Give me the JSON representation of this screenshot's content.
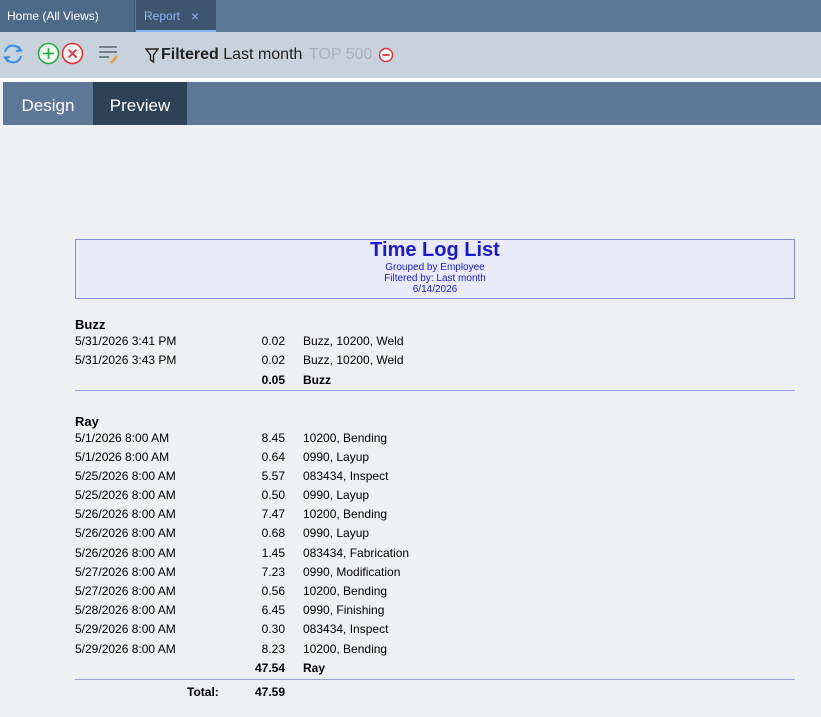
{
  "tabs": [
    {
      "label": "Home (All Views)"
    },
    {
      "label": "Report",
      "close_icon": "×"
    }
  ],
  "toolbar": {
    "filter_bold": "Filtered",
    "filter_value": "Last month",
    "top_label": "TOP 500",
    "icons": [
      "refresh-icon",
      "add-icon",
      "remove-icon",
      "edit-columns-icon",
      "filter-icon",
      "clear-filter-icon"
    ]
  },
  "view_tabs": [
    {
      "label": "Design"
    },
    {
      "label": "Preview"
    }
  ],
  "report": {
    "title": "Time Log List",
    "grouped": "Grouped by Employee",
    "filtered": "Filtered by: Last month",
    "date": "6/14/2026",
    "groups": [
      {
        "name": "Buzz",
        "rows": [
          {
            "time": "5/31/2026 3:41 PM",
            "hours": "0.02",
            "desc": "Buzz, 10200, Weld"
          },
          {
            "time": "5/31/2026 3:43 PM",
            "hours": "0.02",
            "desc": "Buzz, 10200, Weld"
          }
        ],
        "subtotal": "0.05",
        "subtotal_label": "Buzz"
      },
      {
        "name": "Ray",
        "rows": [
          {
            "time": "5/1/2026 8:00 AM",
            "hours": "8.45",
            "desc": "10200, Bending"
          },
          {
            "time": "5/1/2026 8:00 AM",
            "hours": "0.64",
            "desc": "0990, Layup"
          },
          {
            "time": "5/25/2026 8:00 AM",
            "hours": "5.57",
            "desc": "083434, Inspect"
          },
          {
            "time": "5/25/2026 8:00 AM",
            "hours": "0.50",
            "desc": "0990, Layup"
          },
          {
            "time": "5/26/2026 8:00 AM",
            "hours": "7.47",
            "desc": "10200, Bending"
          },
          {
            "time": "5/26/2026 8:00 AM",
            "hours": "0.68",
            "desc": "0990, Layup"
          },
          {
            "time": "5/26/2026 8:00 AM",
            "hours": "1.45",
            "desc": "083434, Fabrication"
          },
          {
            "time": "5/27/2026 8:00 AM",
            "hours": "7.23",
            "desc": "0990, Modification"
          },
          {
            "time": "5/27/2026 8:00 AM",
            "hours": "0.56",
            "desc": "10200, Bending"
          },
          {
            "time": "5/28/2026 8:00 AM",
            "hours": "6.45",
            "desc": "0990, Finishing"
          },
          {
            "time": "5/29/2026 8:00 AM",
            "hours": "0.30",
            "desc": "083434, Inspect"
          },
          {
            "time": "5/29/2026 8:00 AM",
            "hours": "8.23",
            "desc": "10200, Bending"
          }
        ],
        "subtotal": "47.54",
        "subtotal_label": "Ray"
      }
    ],
    "total_label": "Total:",
    "total": "47.59"
  }
}
